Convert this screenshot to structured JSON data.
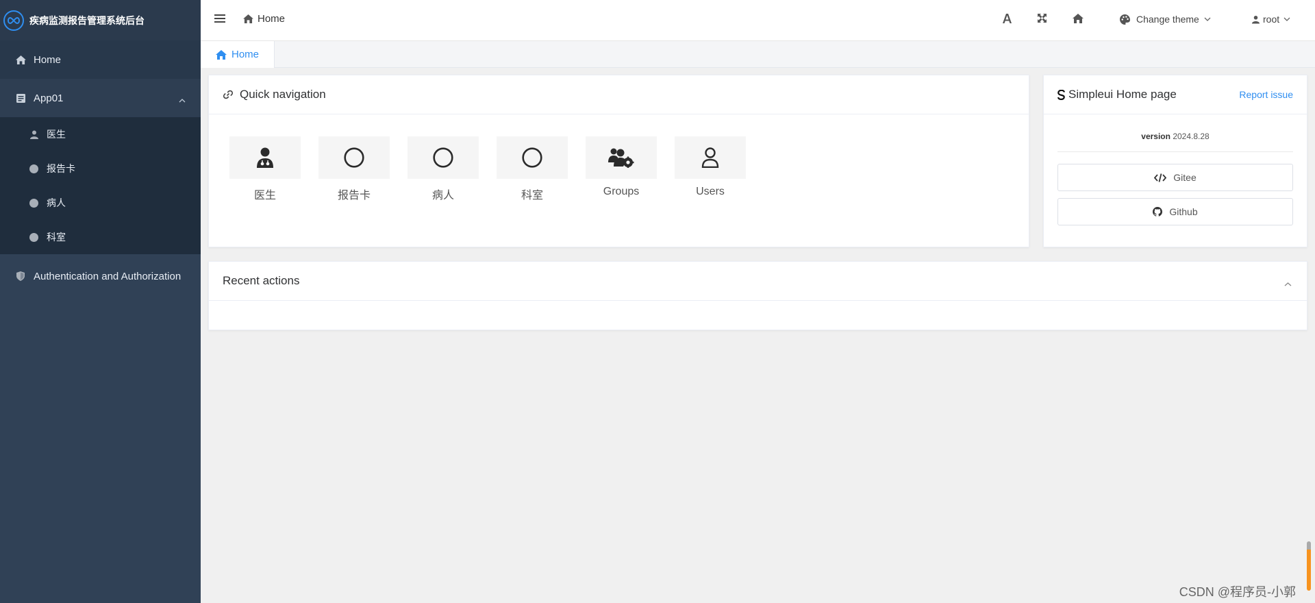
{
  "sidebar": {
    "app_title": "疾病监测报告管理系统后台",
    "items": [
      {
        "label": "Home",
        "icon": "home-icon"
      },
      {
        "label": "App01",
        "icon": "app-icon",
        "expanded": true,
        "children": [
          {
            "label": "医生",
            "icon": "user-icon"
          },
          {
            "label": "报告卡",
            "icon": "dot-icon"
          },
          {
            "label": "病人",
            "icon": "dot-icon"
          },
          {
            "label": "科室",
            "icon": "dot-icon"
          }
        ]
      },
      {
        "label": "Authentication and Authorization",
        "icon": "shield-icon"
      }
    ]
  },
  "topbar": {
    "breadcrumb": "Home",
    "theme_label": "Change theme",
    "user_label": "root"
  },
  "tabs": [
    {
      "label": "Home",
      "active": true
    }
  ],
  "quick_nav": {
    "title": "Quick navigation",
    "items": [
      {
        "label": "医生",
        "icon": "user-doctor-icon"
      },
      {
        "label": "报告卡",
        "icon": "circle-icon"
      },
      {
        "label": "病人",
        "icon": "circle-icon"
      },
      {
        "label": "科室",
        "icon": "circle-icon"
      },
      {
        "label": "Groups",
        "icon": "users-gear-icon"
      },
      {
        "label": "Users",
        "icon": "user-outline-icon"
      }
    ]
  },
  "simpleui": {
    "title": "Simpleui Home page",
    "report_label": "Report issue",
    "version_label": "version",
    "version_value": "2024.8.28",
    "gitee_label": "Gitee",
    "github_label": "Github"
  },
  "recent": {
    "title": "Recent actions"
  },
  "watermark": "CSDN @程序员-小郭",
  "colors": {
    "sidebar_bg": "#304156",
    "accent": "#2f8ef0",
    "scroll_accent": "#f7931e"
  }
}
